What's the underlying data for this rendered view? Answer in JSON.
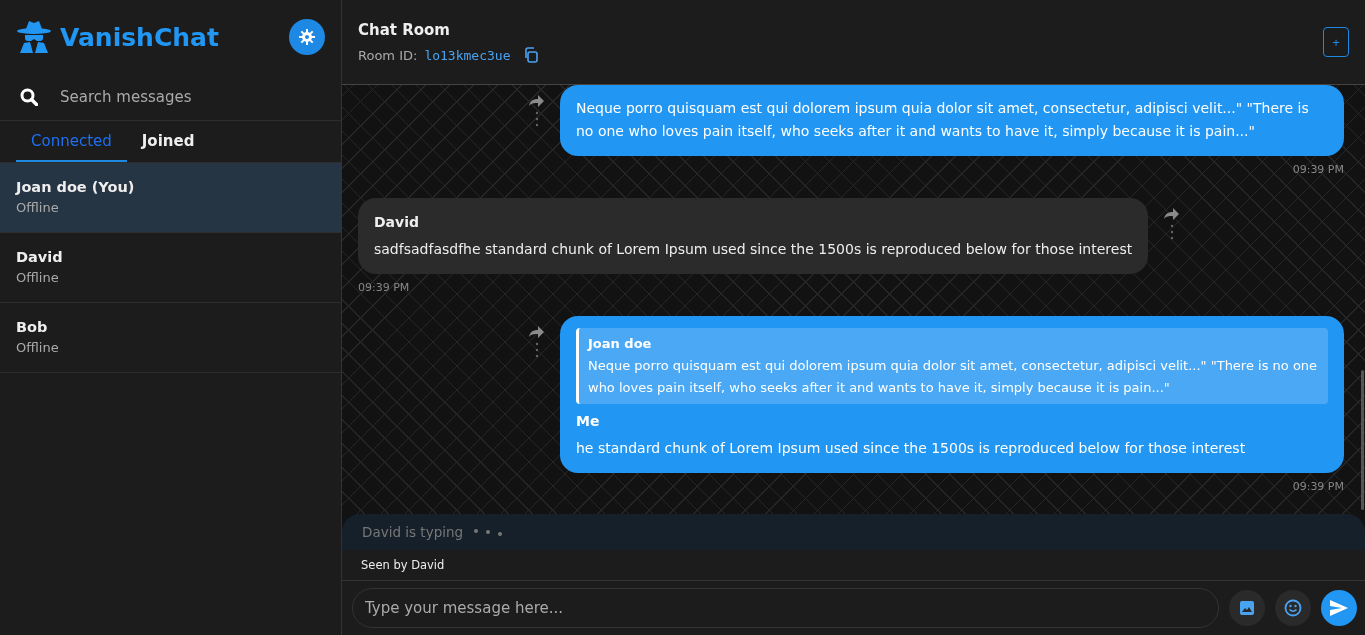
{
  "app": {
    "name": "VanishChat"
  },
  "search": {
    "placeholder": "Search messages"
  },
  "tabs": [
    {
      "label": "Connected",
      "selected": true
    },
    {
      "label": "Joined",
      "selected": false
    }
  ],
  "contacts": [
    {
      "name": "Joan doe (You)",
      "status": "Offline",
      "selected": true
    },
    {
      "name": "David",
      "status": "Offline",
      "selected": false
    },
    {
      "name": "Bob",
      "status": "Offline",
      "selected": false
    }
  ],
  "room": {
    "title": "Chat Room",
    "id_label": "Room ID:",
    "id": "lo13kmec3ue",
    "add_button": "+"
  },
  "messages": [
    {
      "kind": "outgoing",
      "text": "Neque porro quisquam est qui dolorem ipsum quia dolor sit amet, consectetur, adipisci velit...\" \"There is no one who loves pain itself, who seeks after it and wants to have it, simply because it is pain...\"",
      "time": "09:39 PM"
    },
    {
      "kind": "incoming",
      "sender": "David",
      "text": "sadfsadfasdfhe standard chunk of Lorem Ipsum used since the 1500s is reproduced below for those interest",
      "time": "09:39 PM"
    },
    {
      "kind": "outgoing",
      "quote": {
        "sender": "Joan doe",
        "text": "Neque porro quisquam est qui dolorem ipsum quia dolor sit amet, consectetur, adipisci velit...\" \"There is no one who loves pain itself, who seeks after it and wants to have it, simply because it is pain...\""
      },
      "sender": "Me",
      "text": "he standard chunk of Lorem Ipsum used since the 1500s is reproduced below for those interest",
      "time": "09:39 PM"
    }
  ],
  "typing": "David is typing",
  "seen": "Seen by David",
  "composer": {
    "placeholder": "Type your message here..."
  }
}
